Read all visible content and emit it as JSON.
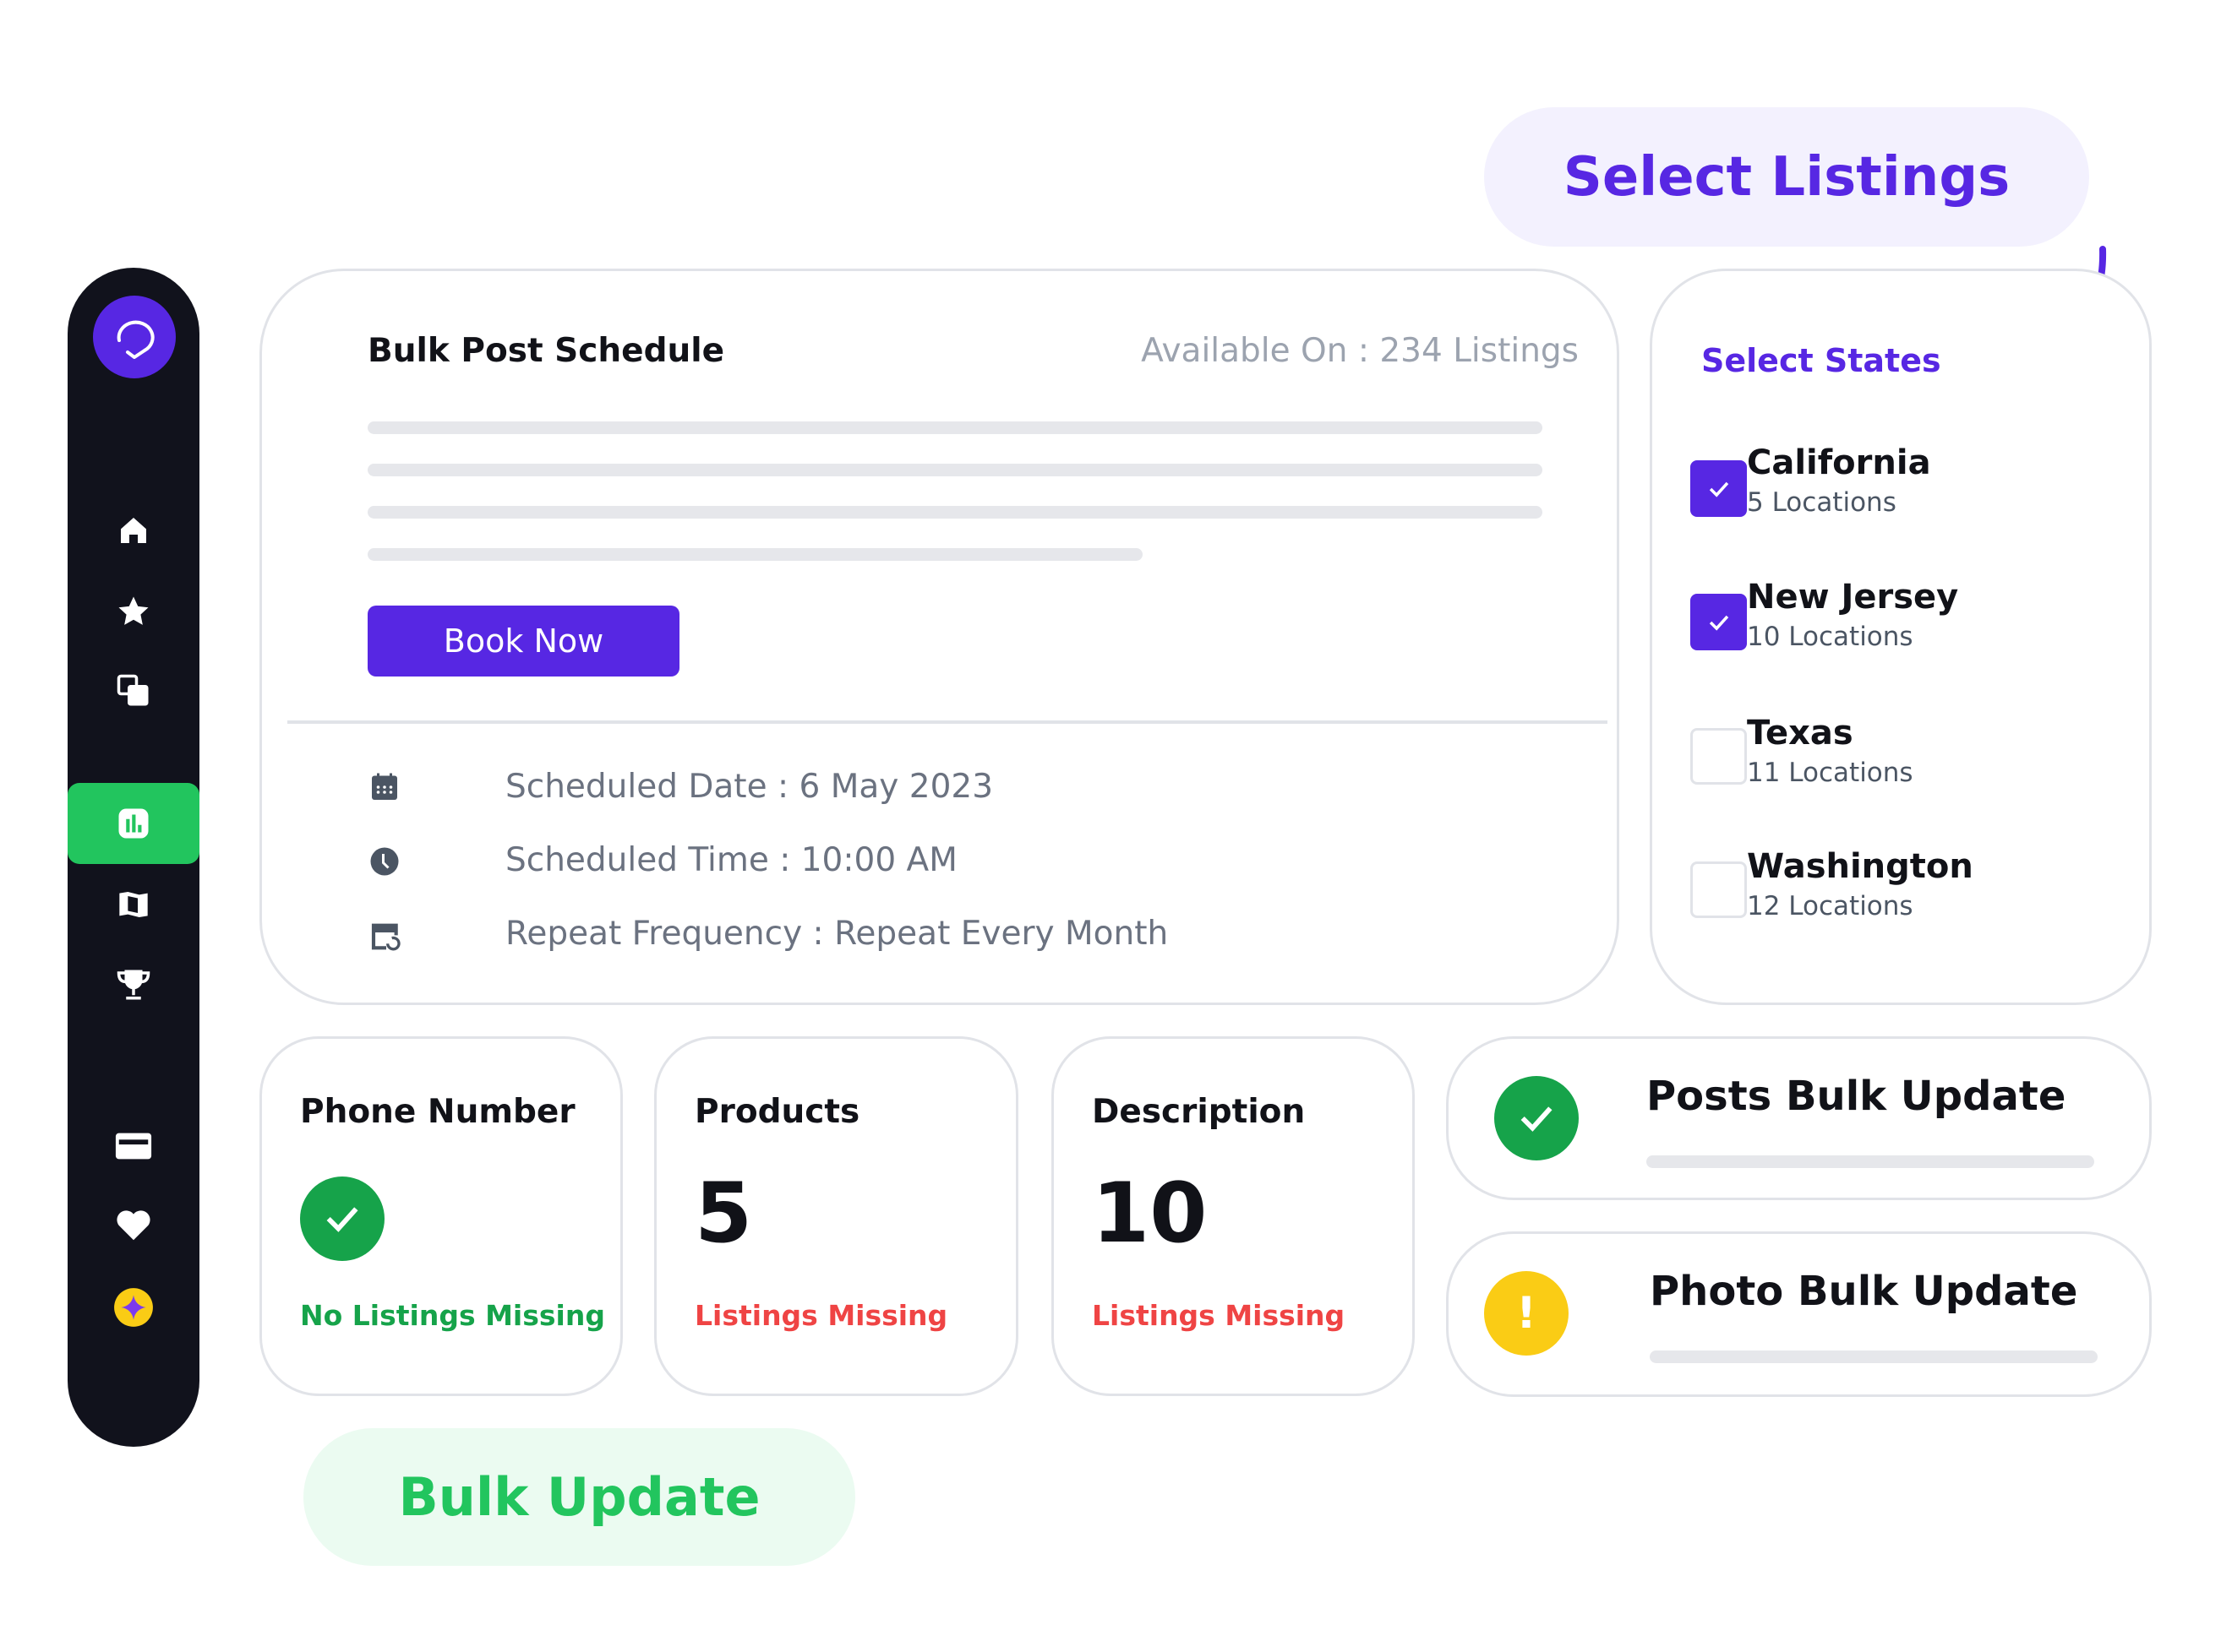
{
  "sidebar": {
    "items": [
      {
        "icon": "home-icon"
      },
      {
        "icon": "star-icon"
      },
      {
        "icon": "copy-icon"
      },
      {
        "icon": "chart-icon",
        "active": true
      },
      {
        "icon": "map-icon"
      },
      {
        "icon": "trophy-icon"
      },
      {
        "icon": "credit-card-icon"
      },
      {
        "icon": "heart-icon"
      },
      {
        "icon": "sparkle-coin-icon"
      }
    ]
  },
  "colors": {
    "primary": "#5727e3",
    "success": "#22c55e",
    "danger": "#ef4444",
    "warning": "#facc15",
    "sidebar": "#11121c"
  },
  "select_listings_label": "Select Listings",
  "bulk_update_label": "Bulk Update",
  "schedule": {
    "title": "Bulk Post Schedule",
    "available": "Available On : 234 Listings",
    "book_now": "Book Now",
    "date": "Scheduled Date : 6 May 2023",
    "time": "Scheduled Time : 10:00 AM",
    "repeat": "Repeat Frequency : Repeat Every Month"
  },
  "states": {
    "title": "Select States",
    "items": [
      {
        "name": "California",
        "count": "5 Locations",
        "checked": true
      },
      {
        "name": "New Jersey",
        "count": "10 Locations",
        "checked": true
      },
      {
        "name": "Texas",
        "count": "11 Locations",
        "checked": false
      },
      {
        "name": "Washington",
        "count": "12 Locations",
        "checked": false
      }
    ]
  },
  "stats": [
    {
      "title": "Phone Number",
      "status": "No Listings Missing"
    },
    {
      "title": "Products",
      "value": "5",
      "status": "Listings Missing"
    },
    {
      "title": "Description",
      "value": "10",
      "status": "Listings Missing"
    }
  ],
  "updates": [
    {
      "title": "Posts Bulk Update",
      "status": "complete"
    },
    {
      "title": "Photo Bulk Update",
      "status": "warning"
    }
  ]
}
